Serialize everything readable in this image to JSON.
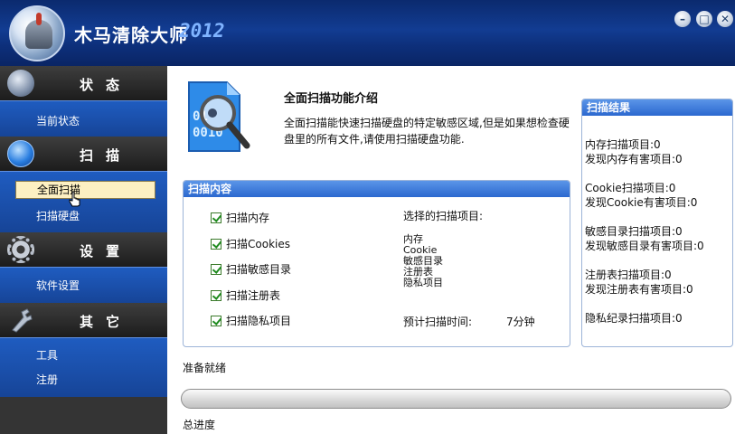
{
  "window": {
    "title": "木马清除大师",
    "year": "2012",
    "buttons": {
      "minimize": "–",
      "maximize": "□",
      "close": "✕"
    },
    "logo_icon": "trojan-helmet-icon"
  },
  "sidebar": {
    "sections": [
      {
        "label": "状态",
        "icon": "helmet-icon",
        "items": [
          "当前状态"
        ]
      },
      {
        "label": "扫描",
        "icon": "globe-scan-icon",
        "items": [
          "全面扫描",
          "扫描硬盘"
        ]
      },
      {
        "label": "设置",
        "icon": "gear-icon",
        "items": [
          "软件设置"
        ]
      },
      {
        "label": "其它",
        "icon": "wrench-tools-icon",
        "items": [
          "工具",
          "注册"
        ]
      }
    ],
    "selected_item": "全面扫描"
  },
  "intro": {
    "title": "全面扫描功能介绍",
    "text": "全面扫描能快速扫描硬盘的特定敏感区域,但是如果想检查硬盘里的所有文件,请使用扫描硬盘功能.",
    "icon": "magnifier-document-icon"
  },
  "scan_content": {
    "header": "扫描内容",
    "options": [
      {
        "label": "扫描内存",
        "checked": true
      },
      {
        "label": "扫描Cookies",
        "checked": true
      },
      {
        "label": "扫描敏感目录",
        "checked": true
      },
      {
        "label": "扫描注册表",
        "checked": true
      },
      {
        "label": "扫描隐私项目",
        "checked": true
      }
    ],
    "selected_label": "选择的扫描项目:",
    "selected_items": [
      "内存",
      "Cookie",
      "敏感目录",
      "注册表",
      "隐私项目"
    ],
    "eta_label": "预计扫描时间:",
    "eta_value": "7分钟"
  },
  "scan_results": {
    "header": "扫描结果",
    "lines": [
      "内存扫描项目:0",
      "发现内存有害项目:0",
      "Cookie扫描项目:0",
      "发现Cookie有害项目:0",
      "敏感目录扫描项目:0",
      "发现敏感目录有害项目:0",
      "注册表扫描项目:0",
      "发现注册表有害项目:0",
      "隐私纪录扫描项目:0"
    ]
  },
  "status": {
    "text": "准备就绪",
    "progress_label": "总进度",
    "progress_fraction": 0
  },
  "colors": {
    "titlebar": "#123c92",
    "nav_blue": "#1f5cc0",
    "nav_dark": "#343434",
    "panel_head": "#2b68cf",
    "selected_bg": "#fdf0c2"
  }
}
